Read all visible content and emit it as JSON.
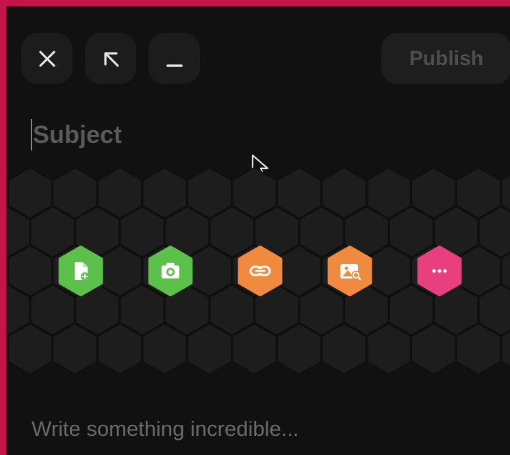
{
  "composer": {
    "subject_placeholder": "Subject",
    "body_placeholder": "Write something incredible...",
    "publish_label": "Publish"
  },
  "window_controls": [
    {
      "name": "close-icon"
    },
    {
      "name": "expand-icon"
    },
    {
      "name": "minimize-icon"
    }
  ],
  "attachment_actions": [
    {
      "name": "file-icon",
      "color": "#5cc14a"
    },
    {
      "name": "camera-icon",
      "color": "#5cc14a"
    },
    {
      "name": "link-icon",
      "color": "#f08a3e"
    },
    {
      "name": "image-icon",
      "color": "#f08a3e"
    },
    {
      "name": "more-icon",
      "color": "#e8407e"
    }
  ],
  "colors": {
    "frame_border": "#c4144a",
    "background": "#111111",
    "hex_tile": "#1d1d1d"
  }
}
